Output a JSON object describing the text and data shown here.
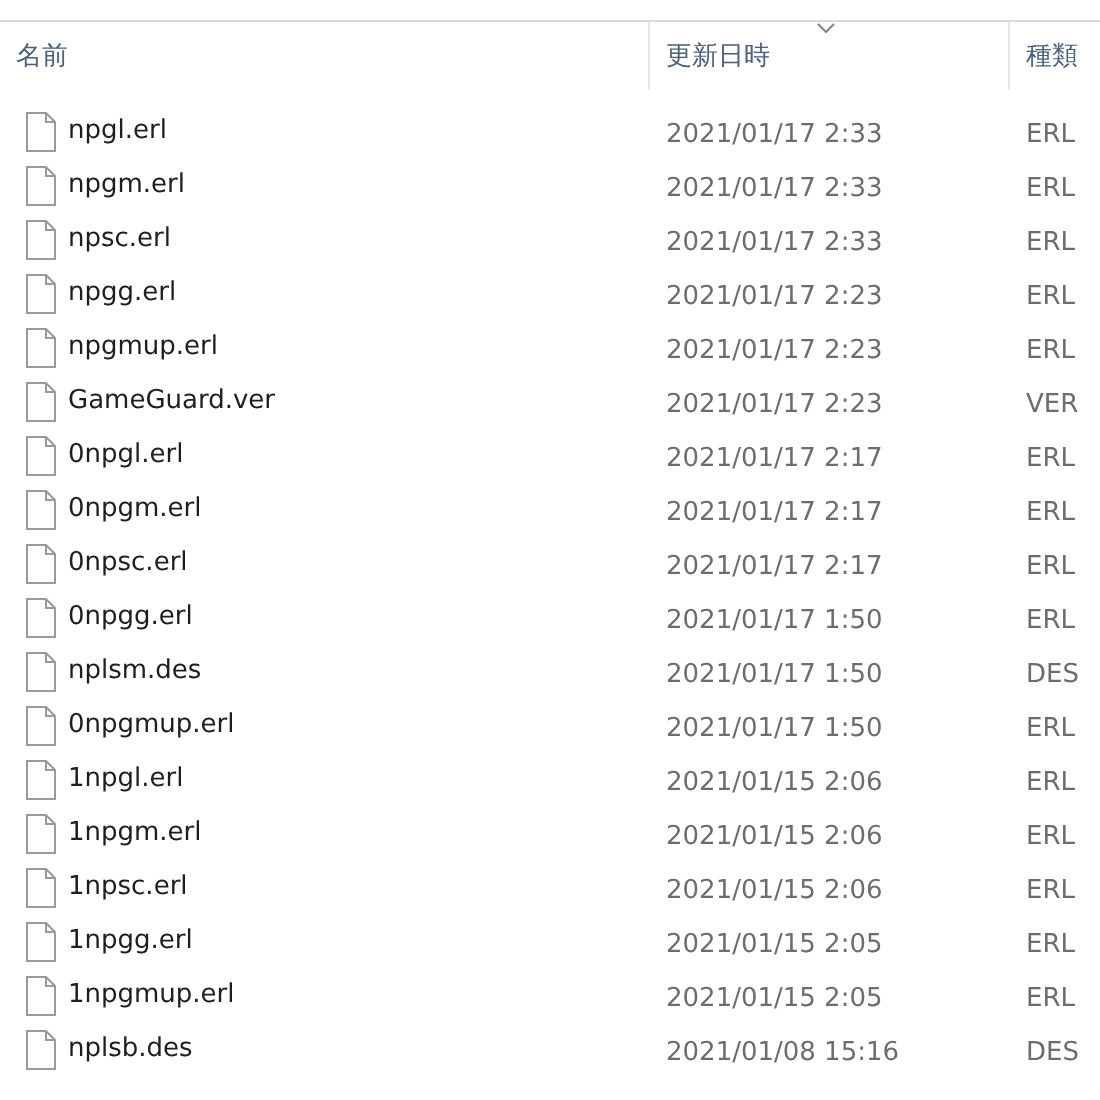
{
  "columns": [
    {
      "label": "名前"
    },
    {
      "label": "更新日時",
      "sorted": true
    },
    {
      "label": "種類"
    }
  ],
  "rows": [
    {
      "name": "npgl.erl",
      "modified": "2021/01/17 2:33",
      "type": "ERL"
    },
    {
      "name": "npgm.erl",
      "modified": "2021/01/17 2:33",
      "type": "ERL"
    },
    {
      "name": "npsc.erl",
      "modified": "2021/01/17 2:33",
      "type": "ERL"
    },
    {
      "name": "npgg.erl",
      "modified": "2021/01/17 2:23",
      "type": "ERL"
    },
    {
      "name": "npgmup.erl",
      "modified": "2021/01/17 2:23",
      "type": "ERL"
    },
    {
      "name": "GameGuard.ver",
      "modified": "2021/01/17 2:23",
      "type": "VER"
    },
    {
      "name": "0npgl.erl",
      "modified": "2021/01/17 2:17",
      "type": "ERL"
    },
    {
      "name": "0npgm.erl",
      "modified": "2021/01/17 2:17",
      "type": "ERL"
    },
    {
      "name": "0npsc.erl",
      "modified": "2021/01/17 2:17",
      "type": "ERL"
    },
    {
      "name": "0npgg.erl",
      "modified": "2021/01/17 1:50",
      "type": "ERL"
    },
    {
      "name": "nplsm.des",
      "modified": "2021/01/17 1:50",
      "type": "DES"
    },
    {
      "name": "0npgmup.erl",
      "modified": "2021/01/17 1:50",
      "type": "ERL"
    },
    {
      "name": "1npgl.erl",
      "modified": "2021/01/15 2:06",
      "type": "ERL"
    },
    {
      "name": "1npgm.erl",
      "modified": "2021/01/15 2:06",
      "type": "ERL"
    },
    {
      "name": "1npsc.erl",
      "modified": "2021/01/15 2:06",
      "type": "ERL"
    },
    {
      "name": "1npgg.erl",
      "modified": "2021/01/15 2:05",
      "type": "ERL"
    },
    {
      "name": "1npgmup.erl",
      "modified": "2021/01/15 2:05",
      "type": "ERL"
    },
    {
      "name": "nplsb.des",
      "modified": "2021/01/08 15:16",
      "type": "DES"
    }
  ]
}
